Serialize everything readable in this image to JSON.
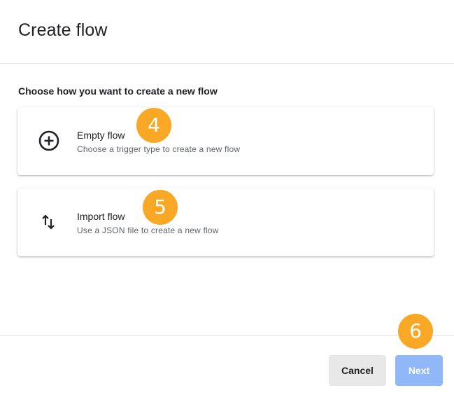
{
  "dialog": {
    "title": "Create flow",
    "subtitle": "Choose how you want to create a new flow"
  },
  "options": [
    {
      "label": "Empty flow",
      "description": "Choose a trigger type to create a new flow",
      "icon": "plus-circle-icon"
    },
    {
      "label": "Import flow",
      "description": "Use a JSON file to create a new flow",
      "icon": "swap-vertical-icon"
    }
  ],
  "badges": [
    "4",
    "5",
    "6"
  ],
  "footer": {
    "cancel_label": "Cancel",
    "next_label": "Next"
  },
  "colors": {
    "badge": "#f9a825",
    "next_button": "#90b8f8",
    "cancel_button": "#e8e8e8"
  }
}
